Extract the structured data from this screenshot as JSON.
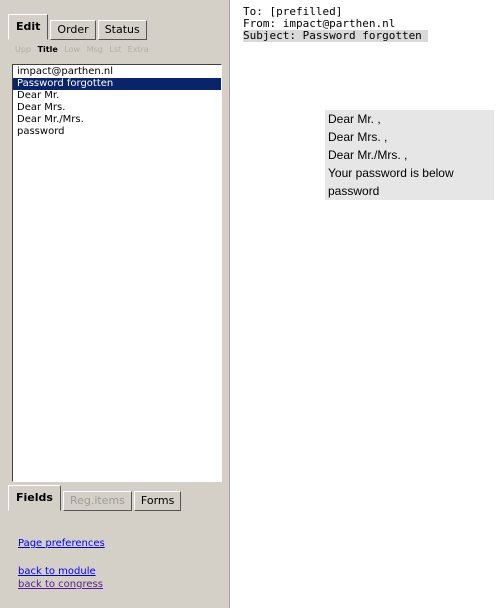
{
  "sidebar": {
    "top_tabs": [
      {
        "label": "Edit",
        "active": true
      },
      {
        "label": "Order",
        "active": false
      },
      {
        "label": "Status",
        "active": false
      }
    ],
    "subtabs": [
      {
        "label": "Upp",
        "selected": false
      },
      {
        "label": "Title",
        "selected": true
      },
      {
        "label": "Low",
        "selected": false
      },
      {
        "label": "Msg",
        "selected": false
      },
      {
        "label": "Lst",
        "selected": false
      },
      {
        "label": "Extra",
        "selected": false
      }
    ],
    "list_items": [
      {
        "label": "impact@parthen.nl",
        "selected": false
      },
      {
        "label": "Password forgotten",
        "selected": true
      },
      {
        "label": "Dear Mr.",
        "selected": false
      },
      {
        "label": "Dear Mrs.",
        "selected": false
      },
      {
        "label": "Dear Mr./Mrs.",
        "selected": false
      },
      {
        "label": "password",
        "selected": false
      }
    ],
    "bottom_tabs": [
      {
        "label": "Fields",
        "active": true
      },
      {
        "label": "Reg.items",
        "active": false,
        "disabled": true
      },
      {
        "label": "Forms",
        "active": false
      }
    ],
    "links": {
      "page_preferences": "Page preferences",
      "back_to_module": "back to module",
      "back_to_congress": "back to congress"
    }
  },
  "email": {
    "to": "To: [prefilled]",
    "from": "From: impact@parthen.nl",
    "subject": "Subject: Password forgotten",
    "body_lines": [
      "Dear Mr. ,",
      "Dear Mrs. ,",
      "Dear Mr./Mrs. ,",
      "Your password is below",
      "password"
    ]
  },
  "colors": {
    "sidebar_bg": "#d4d0c8",
    "selection": "#0a246a",
    "link": "#0000ee",
    "visited_link": "#551a8b"
  }
}
